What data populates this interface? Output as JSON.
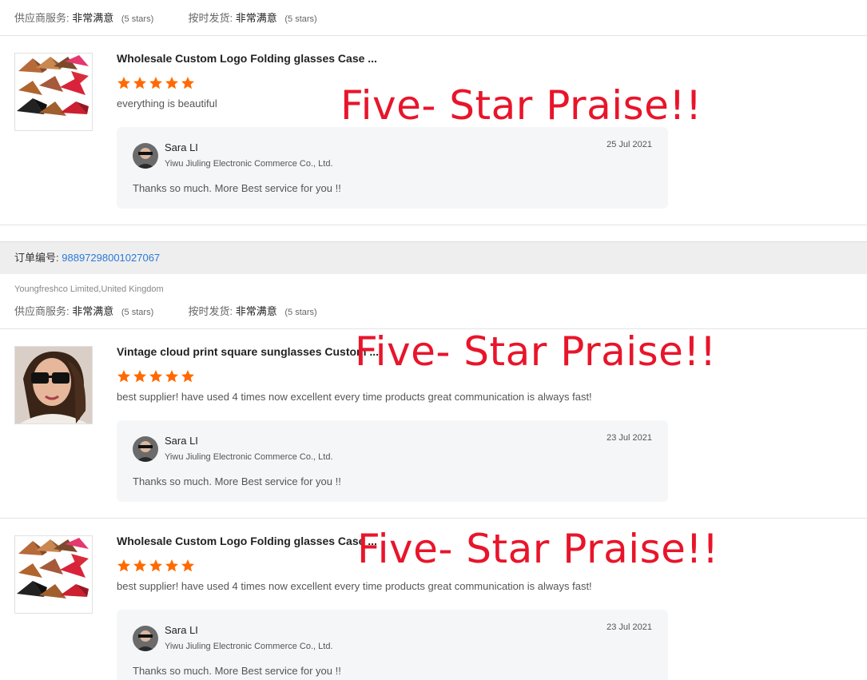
{
  "ratings": {
    "supplier_label": "供应商服务:",
    "supplier_value": "非常满意",
    "supplier_stars": "(5 stars)",
    "ontime_label": "按时发货:",
    "ontime_value": "非常满意",
    "ontime_stars": "(5 stars)"
  },
  "order": {
    "label": "订单编号:",
    "number": "98897298001027067",
    "buyer_location": "Youngfreshco Limited,United Kingdom"
  },
  "reviews": [
    {
      "product_title": "Wholesale Custom Logo Folding glasses Case ...",
      "stars": 5,
      "text": "everything is beautiful",
      "reply": {
        "name": "Sara LI",
        "company": "Yiwu Jiuling Electronic Commerce Co., Ltd.",
        "date": "25 Jul 2021",
        "message": "Thanks so much. More Best service for you !!"
      },
      "overlay": "Five- Star Praise!!"
    },
    {
      "product_title": "Vintage cloud print square sunglasses Custom ...",
      "stars": 5,
      "text": "best supplier! have used 4 times now excellent every time products great communication is always fast!",
      "reply": {
        "name": "Sara LI",
        "company": "Yiwu Jiuling Electronic Commerce Co., Ltd.",
        "date": "23 Jul 2021",
        "message": "Thanks so much. More Best service for you !!"
      },
      "overlay": "Five- Star Praise!!"
    },
    {
      "product_title": "Wholesale Custom Logo Folding glasses Case ...",
      "stars": 5,
      "text": "best supplier! have used 4 times now excellent every time products great communication is always fast!",
      "reply": {
        "name": "Sara LI",
        "company": "Yiwu Jiuling Electronic Commerce Co., Ltd.",
        "date": "23 Jul 2021",
        "message": "Thanks so much. More Best service for you !!"
      },
      "overlay": "Five- Star Praise!!"
    }
  ],
  "colors": {
    "star": "#ff6a00",
    "overlay": "#e8152a",
    "link": "#2a7ad8"
  },
  "icons": {
    "star": "star-icon",
    "avatar": "avatar"
  }
}
